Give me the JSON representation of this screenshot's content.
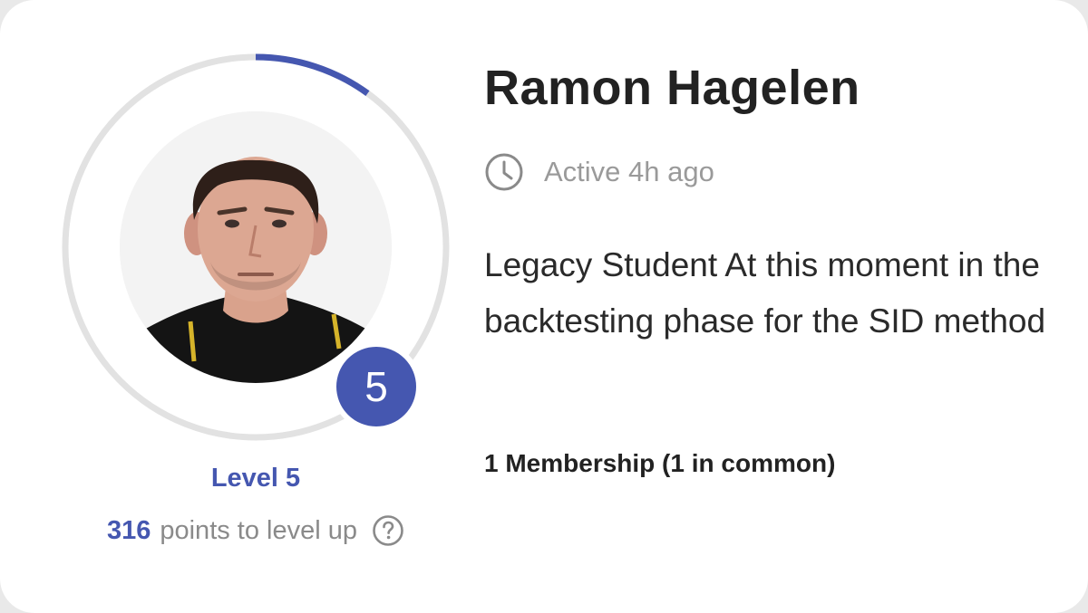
{
  "profile": {
    "name": "Ramon Hagelen",
    "active": "Active 4h ago",
    "bio": "Legacy Student At this moment in the backtesting phase for the SID method",
    "membership": "1 Membership (1 in common)"
  },
  "level": {
    "badge": "5",
    "label": "Level 5",
    "points_value": "316",
    "points_text": "points to level up",
    "progress_fraction": 0.1
  },
  "icons": {
    "clock": "clock-icon",
    "help": "question-circle-icon"
  },
  "colors": {
    "accent": "#4557b0",
    "ring_track": "#e2e2e2",
    "muted_text": "#8a8a8a",
    "card_bg": "#ffffff",
    "page_bg": "#e9e9e9"
  }
}
